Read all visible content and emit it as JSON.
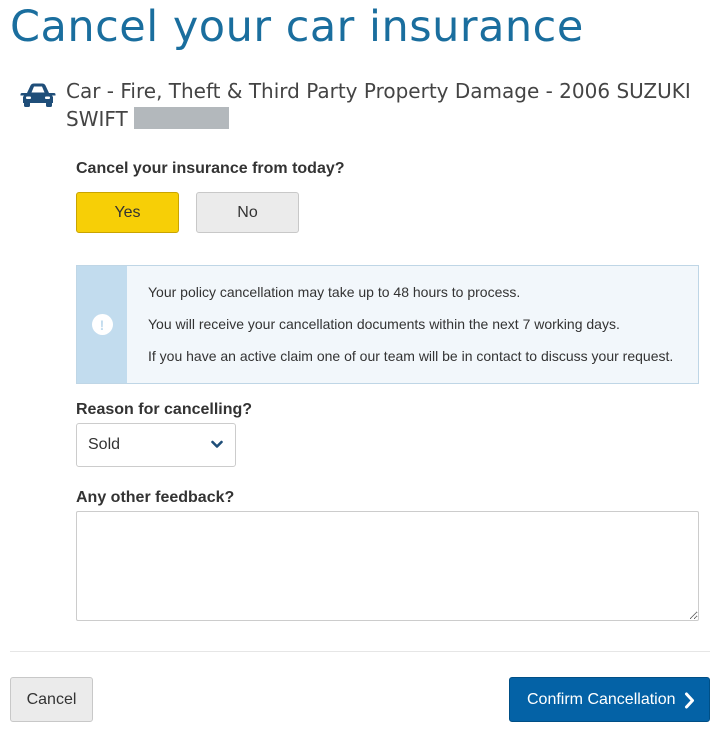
{
  "page": {
    "title": "Cancel your car insurance"
  },
  "policy": {
    "icon": "car-icon",
    "title": "Car - Fire, Theft & Third Party Property Damage - 2006 SUZUKI SWIFT"
  },
  "cancel_today": {
    "question": "Cancel your insurance from today?",
    "yes_label": "Yes",
    "no_label": "No",
    "selected": "Yes"
  },
  "info": {
    "icon": "exclamation-circle-icon",
    "lines": [
      "Your policy cancellation may take up to 48 hours to process.",
      "You will receive your cancellation documents within the next 7 working days.",
      "If you have an active claim one of our team will be in contact to discuss your request."
    ]
  },
  "reason": {
    "label": "Reason for cancelling?",
    "selected_value": "Sold"
  },
  "feedback": {
    "label": "Any other feedback?",
    "value": ""
  },
  "actions": {
    "cancel_label": "Cancel",
    "confirm_label": "Confirm Cancellation"
  },
  "colors": {
    "title": "#1a6e9e",
    "yes_selected": "#f7cf06",
    "info_strip": "#c2dcee",
    "info_background": "#f2f7fb",
    "confirm_button": "#0462a6"
  }
}
